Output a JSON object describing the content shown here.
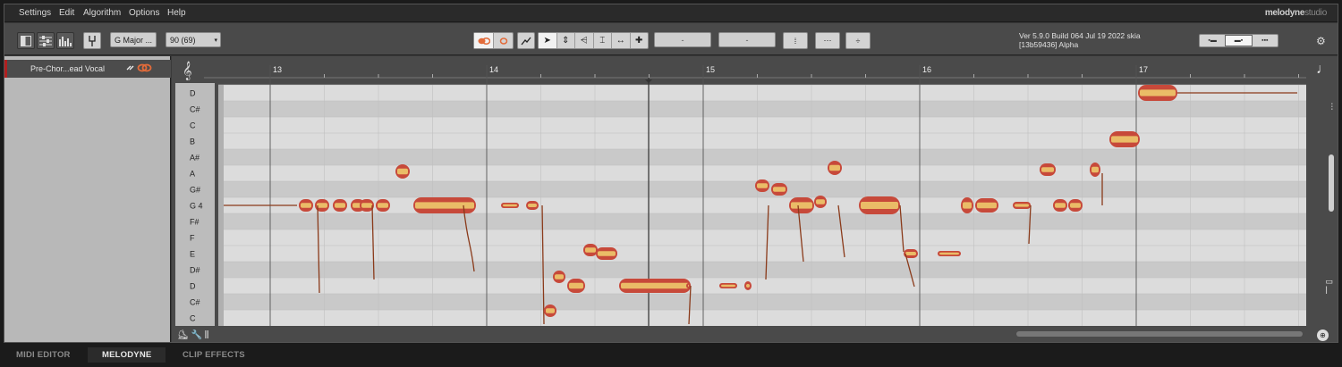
{
  "menu": [
    "Settings",
    "Edit",
    "Algorithm",
    "Options",
    "Help"
  ],
  "brand": {
    "main": "melodyne",
    "sub": "studio"
  },
  "toolbar": {
    "scale": "G Major ...",
    "tempo": "90 (69)",
    "field1": "-",
    "field2": "-"
  },
  "version": {
    "line1": "Ver 5.9.0 Build 064 Jul 19 2022 skia",
    "line2": "[13b59436] Alpha"
  },
  "track": {
    "name": "Pre-Chor...ead Vocal"
  },
  "bars": [
    "13",
    "14",
    "15",
    "16",
    "17"
  ],
  "pitches": [
    "D",
    "C#",
    "C",
    "B",
    "A#",
    "A",
    "G#",
    "G 4",
    "F#",
    "F",
    "E",
    "D#",
    "D",
    "C#",
    "C"
  ],
  "tabs": [
    "MIDI EDITOR",
    "MELODYNE",
    "CLIP EFFECTS"
  ],
  "colors": {
    "blob_fill": "#c7493a",
    "blob_core": "#f0d070",
    "pitch_line": "#8a3a1a",
    "accent_red": "#b02020"
  },
  "icons": [
    "layout-icon",
    "mixer-icon",
    "levels-icon",
    "tuning-fork-icon",
    "blob-link-icon",
    "pointer-tool-icon",
    "pitch-tool-icon",
    "amplitude-tool-icon",
    "formant-tool-icon",
    "time-tool-icon",
    "note-separation-icon",
    "gear-icon",
    "treble-clef-icon",
    "note-icon"
  ]
}
